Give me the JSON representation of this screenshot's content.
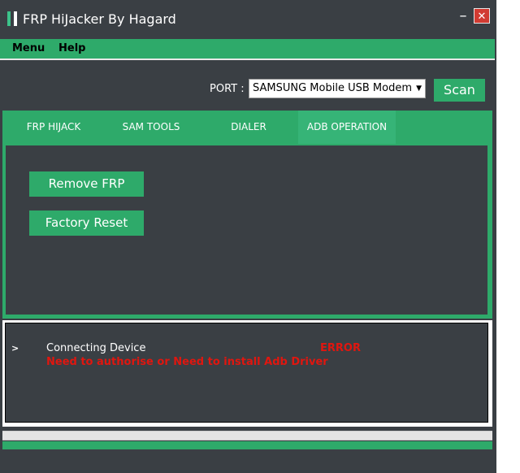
{
  "window": {
    "title": "FRP HiJacker By Hagard",
    "minimize": "–",
    "close": "✕"
  },
  "menu": [
    {
      "label": "Menu"
    },
    {
      "label": "Help"
    }
  ],
  "port": {
    "label": "PORT :",
    "selected": "SAMSUNG Mobile USB Modem #"
  },
  "scan_label": "Scan",
  "tabs": [
    {
      "label": "FRP HIJACK"
    },
    {
      "label": "SAM TOOLS"
    },
    {
      "label": "DIALER"
    },
    {
      "label": "ADB OPERATION",
      "active": true
    }
  ],
  "actions": {
    "remove_frp": "Remove FRP",
    "factory_reset": "Factory Reset"
  },
  "log": {
    "prompt": ">",
    "message": "Connecting Device",
    "status": "ERROR",
    "detail": "Need to authorise or Need to install Adb Driver"
  },
  "colors": {
    "accent": "#2eaa6a",
    "background": "#3a3f44",
    "error": "#e0160f"
  }
}
